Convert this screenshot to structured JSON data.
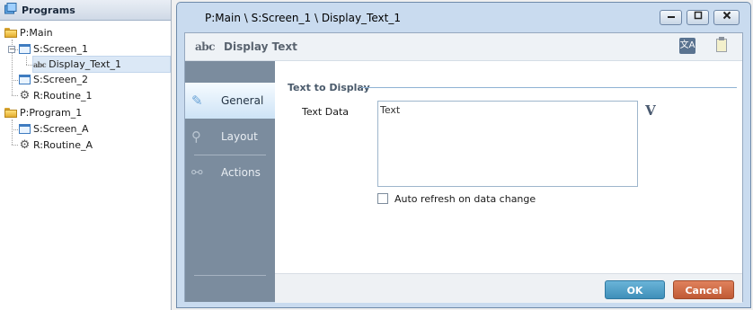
{
  "tree": {
    "header": "Programs",
    "nodes": [
      {
        "label": "P:Main"
      },
      {
        "label": "S:Screen_1"
      },
      {
        "label": "Display_Text_1"
      },
      {
        "label": "S:Screen_2"
      },
      {
        "label": "R:Routine_1"
      },
      {
        "label": "P:Program_1"
      },
      {
        "label": "S:Screen_A"
      },
      {
        "label": "R:Routine_A"
      }
    ]
  },
  "dialog": {
    "title": "P:Main \\ S:Screen_1 \\ Display_Text_1",
    "header_icon_text": "abc",
    "header_title": "Display Text",
    "nav": [
      {
        "label": "General"
      },
      {
        "label": "Layout"
      },
      {
        "label": "Actions"
      }
    ],
    "section_title": "Text to Display",
    "text_data_label": "Text Data",
    "text_data_value": "Text",
    "variable_button": "V",
    "auto_refresh_label": "Auto refresh on data change",
    "auto_refresh_checked": false,
    "ok_label": "OK",
    "cancel_label": "Cancel"
  },
  "colors": {
    "ok_button": "#3f8fb9",
    "cancel_button": "#c05a35",
    "side_nav": "#7b8c9e",
    "section_line": "#8fb2d4"
  }
}
